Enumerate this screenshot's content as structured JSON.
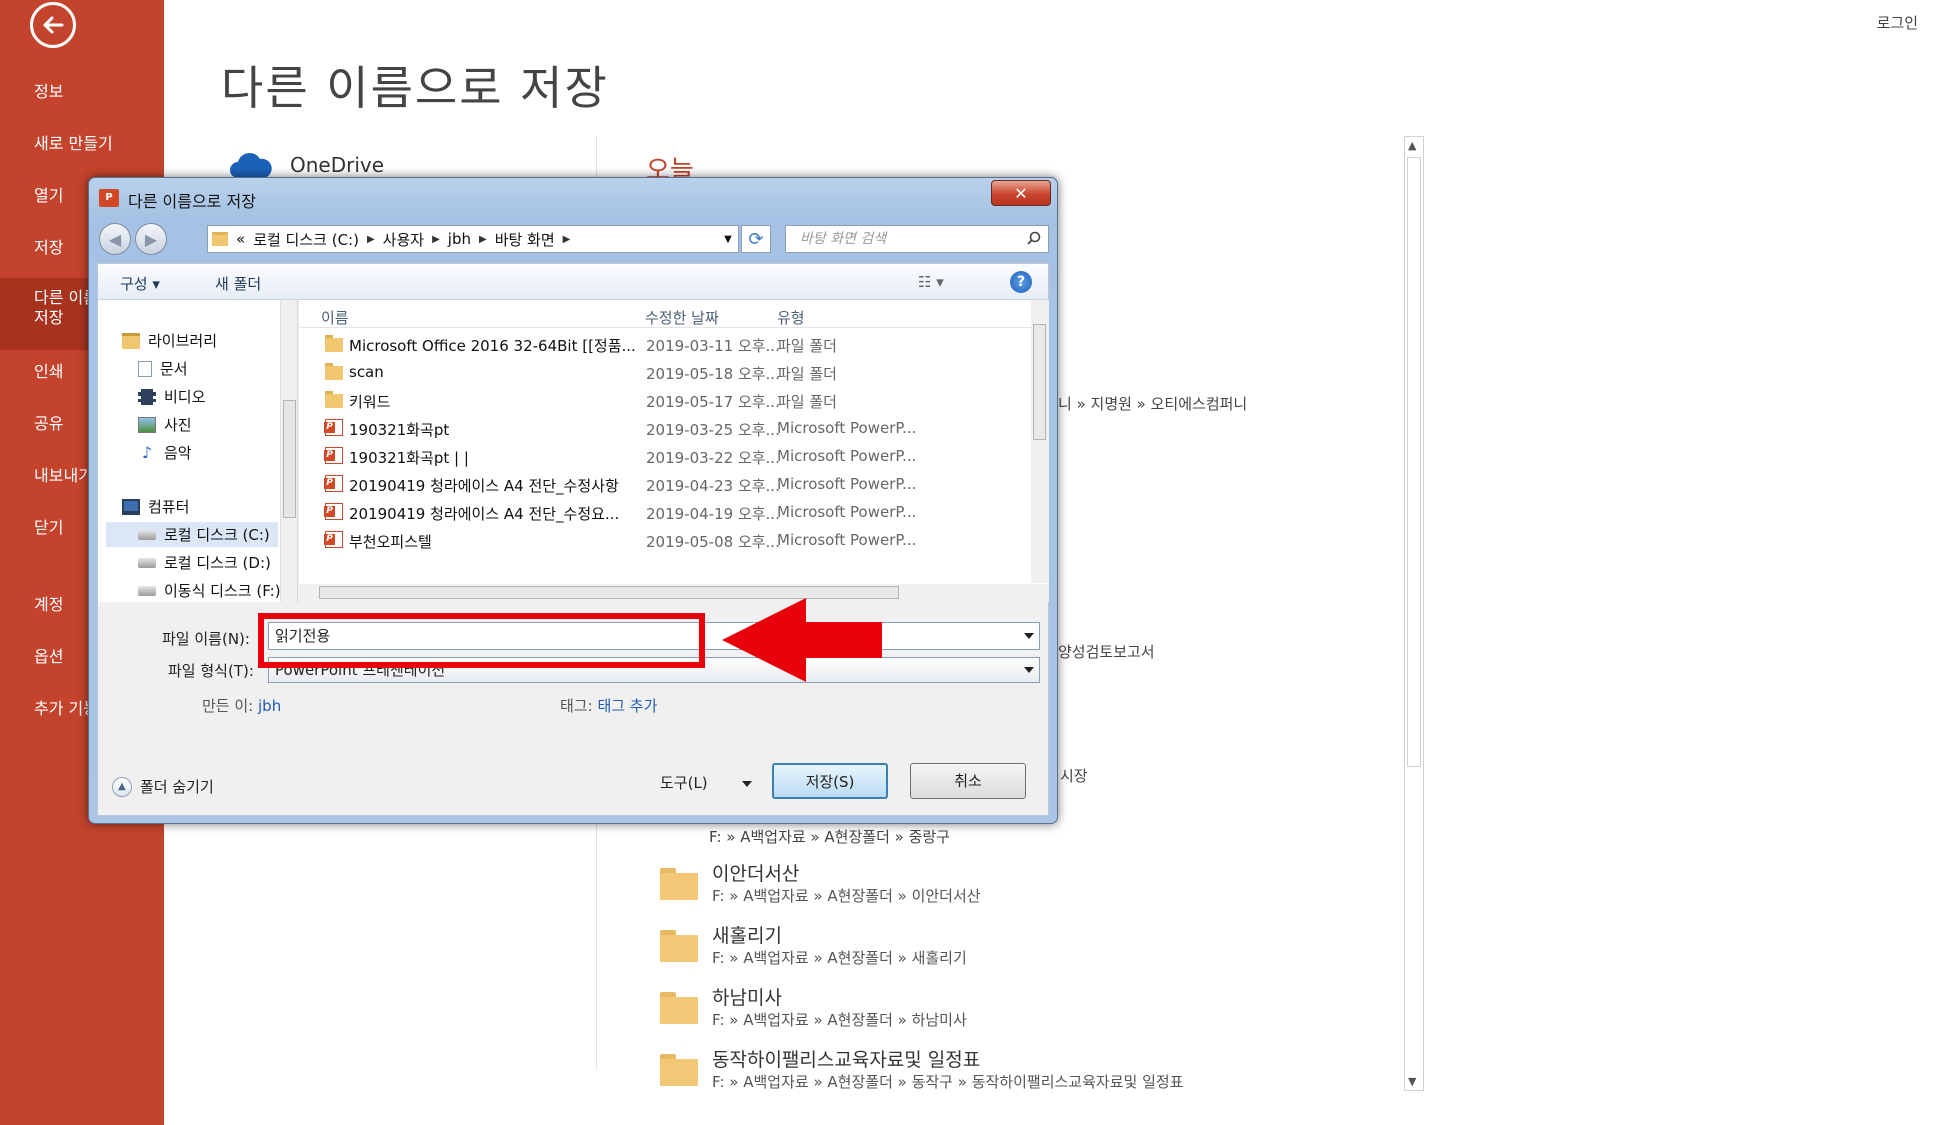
{
  "header": {
    "login": "로그인",
    "page_title": "다른 이름으로 저장"
  },
  "nav": {
    "items": [
      "정보",
      "새로 만들기",
      "열기",
      "저장",
      "인쇄",
      "공유",
      "내보내기",
      "닫기",
      "계정",
      "옵션",
      "추가 기능"
    ],
    "active_line1": "다른 이름으로",
    "active_line2": "저장"
  },
  "background": {
    "onedrive": "OneDrive",
    "today": "오늘",
    "crumb_1": "니 » 지명원 » 오티에스컴퍼니",
    "crumb_2": "양성검토보고서",
    "crumb_3": "시장",
    "crumb_4": "F: » A백업자료 » A현장폴더 » 중랑구",
    "recent": [
      {
        "name": "이안더서산",
        "path": "F: » A백업자료 » A현장폴더 » 이안더서산"
      },
      {
        "name": "새홀리기",
        "path": "F: » A백업자료 » A현장폴더 » 새홀리기"
      },
      {
        "name": "하남미사",
        "path": "F: » A백업자료 » A현장폴더 » 하남미사"
      },
      {
        "name": "동작하이팰리스교육자료및 일정표",
        "path": "F: » A백업자료 » A현장폴더 » 동작구 » 동작하이팰리스교육자료및 일정표"
      }
    ]
  },
  "dialog": {
    "title": "다른 이름으로 저장",
    "close": "✕",
    "address": {
      "prefix": "«",
      "parts": [
        "로컬 디스크 (C:)",
        "사용자",
        "jbh",
        "바탕 화면"
      ]
    },
    "search_placeholder": "바탕 화면 검색",
    "toolbar": {
      "organize": "구성 ▾",
      "new_folder": "새 폴더",
      "help": "?"
    },
    "tree": [
      {
        "label": "라이브러리",
        "icon": "library-icon"
      },
      {
        "label": "문서",
        "icon": "document-icon"
      },
      {
        "label": "비디오",
        "icon": "video-icon"
      },
      {
        "label": "사진",
        "icon": "picture-icon"
      },
      {
        "label": "음악",
        "icon": "music-icon"
      },
      {
        "label": "컴퓨터",
        "icon": "computer-icon"
      },
      {
        "label": "로컬 디스크 (C:)",
        "icon": "drive-icon"
      },
      {
        "label": "로컬 디스크 (D:)",
        "icon": "drive-icon"
      },
      {
        "label": "이동식 디스크 (F:)",
        "icon": "drive-icon"
      }
    ],
    "columns": {
      "name": "이름",
      "date": "수정한 날짜",
      "type": "유형"
    },
    "files": [
      {
        "name": "Microsoft Office 2016 32-64Bit [[정품...",
        "date": "2019-03-11 오후...",
        "type": "파일 폴더",
        "kind": "folder"
      },
      {
        "name": "scan",
        "date": "2019-05-18 오후...",
        "type": "파일 폴더",
        "kind": "folder"
      },
      {
        "name": "키워드",
        "date": "2019-05-17 오후...",
        "type": "파일 폴더",
        "kind": "folder"
      },
      {
        "name": "190321화곡pt",
        "date": "2019-03-25 오후...",
        "type": "Microsoft PowerP...",
        "kind": "ppt"
      },
      {
        "name": "190321화곡pt | |",
        "date": "2019-03-22 오후...",
        "type": "Microsoft PowerP...",
        "kind": "ppt"
      },
      {
        "name": "20190419 청라에이스 A4 전단_수정사항",
        "date": "2019-04-23 오후...",
        "type": "Microsoft PowerP...",
        "kind": "ppt"
      },
      {
        "name": "20190419 청라에이스 A4 전단_수정요...",
        "date": "2019-04-19 오후...",
        "type": "Microsoft PowerP...",
        "kind": "ppt"
      },
      {
        "name": "부천오피스텔",
        "date": "2019-05-08 오후...",
        "type": "Microsoft PowerP...",
        "kind": "ppt"
      }
    ],
    "filename_label": "파일 이름(N):",
    "filename_value": "읽기전용",
    "filetype_label": "파일 형식(T):",
    "filetype_value": "PowerPoint 프레젠테이션",
    "author_label": "만든 이:",
    "author_value": "jbh",
    "tags_label": "태그:",
    "tags_value": "태그 추가",
    "hide_folders": "폴더 숨기기",
    "tools": "도구(L)",
    "save": "저장(S)",
    "cancel": "취소"
  },
  "colors": {
    "backstage": "#c4432c",
    "annotation": "#e8000b"
  }
}
